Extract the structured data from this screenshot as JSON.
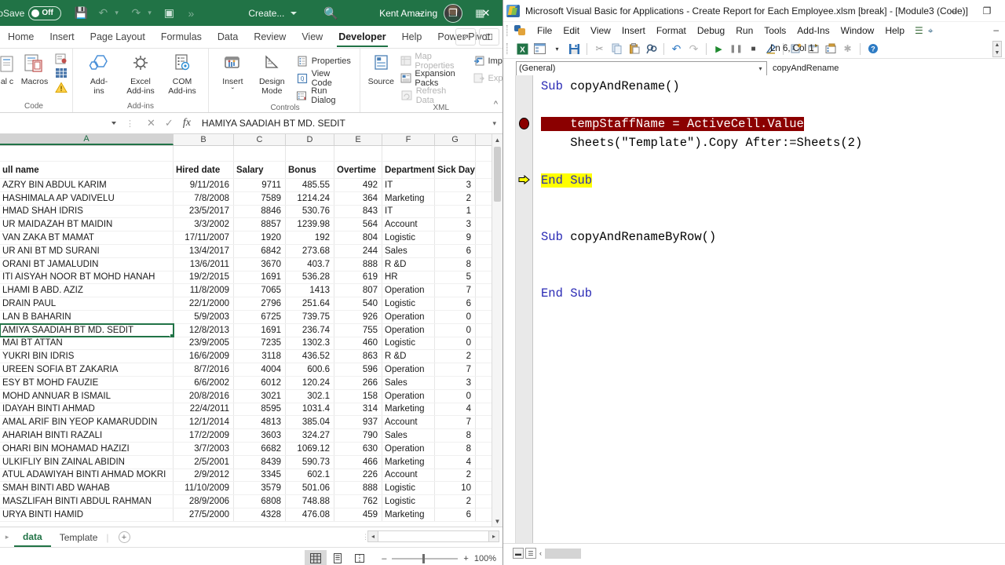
{
  "excel": {
    "titlebar": {
      "autosave_label": "toSave",
      "autosave_state": "Off",
      "qat": [
        "save-icon",
        "undo-icon",
        "redo-icon",
        "touch-mode-icon",
        "more-icon"
      ],
      "create_label": "Create...",
      "search_icon": "search-icon",
      "user_name": "Kent Amazing",
      "ribbon_display_icon": "ribbon-display-options-icon",
      "window_minimize": "–",
      "window_restore": "❐",
      "window_close": "✕"
    },
    "tabs": [
      {
        "label": "Home",
        "active": false
      },
      {
        "label": "Insert",
        "active": false
      },
      {
        "label": "Page Layout",
        "active": false
      },
      {
        "label": "Formulas",
        "active": false
      },
      {
        "label": "Data",
        "active": false
      },
      {
        "label": "Review",
        "active": false
      },
      {
        "label": "View",
        "active": false
      },
      {
        "label": "Developer",
        "active": true
      },
      {
        "label": "Help",
        "active": false
      },
      {
        "label": "Power Pivot",
        "active": false
      }
    ],
    "tab_right": [
      "share-icon",
      "comments-icon"
    ],
    "ribbon": {
      "groups": [
        {
          "title": "Code",
          "big": [
            {
              "label": "al\nc",
              "icon": "visual-basic-icon"
            },
            {
              "label": "Macros",
              "icon": "macros-icon"
            }
          ],
          "icons": [
            "record-macro-icon",
            "use-relative-references-icon",
            "macro-security-icon"
          ]
        },
        {
          "title": "Add-ins",
          "big": [
            {
              "label": "Add-\nins",
              "icon": "addins-icon"
            },
            {
              "label": "Excel\nAdd-ins",
              "icon": "excel-addins-icon"
            },
            {
              "label": "COM\nAdd-ins",
              "icon": "com-addins-icon"
            }
          ],
          "icons": []
        },
        {
          "title": "Controls",
          "big": [
            {
              "label": "Insert\nˇ",
              "icon": "insert-control-icon"
            },
            {
              "label": "Design\nMode",
              "icon": "design-mode-icon"
            }
          ],
          "small": [
            {
              "label": "Properties",
              "icon": "properties-icon",
              "disabled": false
            },
            {
              "label": "View Code",
              "icon": "view-code-icon",
              "disabled": false
            },
            {
              "label": "Run Dialog",
              "icon": "run-dialog-icon",
              "disabled": false
            }
          ]
        },
        {
          "title": "XML",
          "big": [
            {
              "label": "Source",
              "icon": "xml-source-icon"
            }
          ],
          "small": [
            {
              "label": "Map Properties",
              "icon": "map-properties-icon",
              "disabled": true
            },
            {
              "label": "Expansion Packs",
              "icon": "expansion-packs-icon",
              "disabled": false
            },
            {
              "label": "Refresh Data",
              "icon": "refresh-data-icon",
              "disabled": true
            }
          ],
          "small2": [
            {
              "label": "Import",
              "icon": "import-icon",
              "disabled": false
            },
            {
              "label": "Export",
              "icon": "export-icon",
              "disabled": true
            }
          ]
        }
      ],
      "collapse_icon": "collapse-ribbon-icon"
    },
    "formula_bar": {
      "name_box_value": "",
      "cancel_icon": "cancel-icon",
      "enter_icon": "enter-icon",
      "fx_icon": "insert-function-icon",
      "formula_value": "HAMIYA SAADIAH BT MD. SEDIT",
      "expand_icon": "expand-formula-bar-icon"
    },
    "grid": {
      "column_headers": [
        "A",
        "B",
        "C",
        "D",
        "E",
        "F",
        "G"
      ],
      "selected_column": "A",
      "selected_cell_text": "HAMIYA SAADIAH BT MD. SEDIT",
      "header_row": [
        "ull name",
        "Hired date",
        "Salary",
        "Bonus",
        "Overtime",
        "Department",
        "Sick Day"
      ],
      "rows": [
        [
          "AZRY BIN ABDUL KARIM",
          "9/11/2016",
          "9711",
          "485.55",
          "492",
          "IT",
          "3"
        ],
        [
          "HASHIMALA AP VADIVELU",
          "7/8/2008",
          "7589",
          "1214.24",
          "364",
          "Marketing",
          "2"
        ],
        [
          "HMAD SHAH IDRIS",
          "23/5/2017",
          "8846",
          "530.76",
          "843",
          "IT",
          "1"
        ],
        [
          "UR MAIDAZAH BT MAIDIN",
          "3/3/2002",
          "8857",
          "1239.98",
          "564",
          "Account",
          "3"
        ],
        [
          "VAN ZAKA BT MAMAT",
          "17/11/2007",
          "1920",
          "192",
          "804",
          "Logistic",
          "9"
        ],
        [
          "UR ANI BT MD SURANI",
          "13/4/2017",
          "6842",
          "273.68",
          "244",
          "Sales",
          "6"
        ],
        [
          "ORANI BT JAMALUDIN",
          "13/6/2011",
          "3670",
          "403.7",
          "888",
          "R &D",
          "8"
        ],
        [
          "ITI AISYAH NOOR BT MOHD HANAH",
          "19/2/2015",
          "1691",
          "536.28",
          "619",
          "HR",
          "5"
        ],
        [
          "LHAMI B ABD. AZIZ",
          "11/8/2009",
          "7065",
          "1413",
          "807",
          "Operation",
          "7"
        ],
        [
          "DRAIN PAUL",
          "22/1/2000",
          "2796",
          "251.64",
          "540",
          "Logistic",
          "6"
        ],
        [
          "LAN B BAHARIN",
          "5/9/2003",
          "6725",
          "739.75",
          "926",
          "Operation",
          "0"
        ],
        [
          "AMIYA SAADIAH BT MD. SEDIT",
          "12/8/2013",
          "1691",
          "236.74",
          "755",
          "Operation",
          "0"
        ],
        [
          "MAI BT ATTAN",
          "23/9/2005",
          "7235",
          "1302.3",
          "460",
          "Logistic",
          "0"
        ],
        [
          "YUKRI BIN IDRIS",
          "16/6/2009",
          "3118",
          "436.52",
          "863",
          "R &D",
          "2"
        ],
        [
          "UREEN SOFIA BT ZAKARIA",
          "8/7/2016",
          "4004",
          "600.6",
          "596",
          "Operation",
          "7"
        ],
        [
          "ESY BT MOHD FAUZIE",
          "6/6/2002",
          "6012",
          "120.24",
          "266",
          "Sales",
          "3"
        ],
        [
          "MOHD ANNUAR B ISMAIL",
          "20/8/2016",
          "3021",
          "302.1",
          "158",
          "Operation",
          "0"
        ],
        [
          "IDAYAH BINTI AHMAD",
          "22/4/2011",
          "8595",
          "1031.4",
          "314",
          "Marketing",
          "4"
        ],
        [
          "AMAL ARIF BIN YEOP KAMARUDDIN",
          "12/1/2014",
          "4813",
          "385.04",
          "937",
          "Account",
          "7"
        ],
        [
          "AHARIAH BINTI RAZALI",
          "17/2/2009",
          "3603",
          "324.27",
          "790",
          "Sales",
          "8"
        ],
        [
          "OHARI BIN MOHAMAD HAZIZI",
          "3/7/2003",
          "6682",
          "1069.12",
          "630",
          "Operation",
          "8"
        ],
        [
          "ULKIFLIY BIN ZAINAL ABIDIN",
          "2/5/2001",
          "8439",
          "590.73",
          "466",
          "Marketing",
          "4"
        ],
        [
          "ATUL ADAWIYAH BINTI AHMAD MOKRI",
          "2/9/2012",
          "3345",
          "602.1",
          "226",
          "Account",
          "2"
        ],
        [
          "SMAH BINTI ABD WAHAB",
          "11/10/2009",
          "3579",
          "501.06",
          "888",
          "Logistic",
          "10"
        ],
        [
          "MASZLIFAH BINTI ABDUL RAHMAN",
          "28/9/2006",
          "6808",
          "748.88",
          "762",
          "Logistic",
          "2"
        ],
        [
          "URYA BINTI HAMID",
          "27/5/2000",
          "4328",
          "476.08",
          "459",
          "Marketing",
          "6"
        ]
      ],
      "selected_row_index": 11
    },
    "sheet_tabs": [
      {
        "label": "data",
        "active": true
      },
      {
        "label": "Template",
        "active": false
      }
    ],
    "add_sheet_icon": "add-sheet-icon",
    "status": {
      "view_buttons": [
        "normal-view-icon",
        "page-layout-view-icon",
        "page-break-view-icon"
      ],
      "zoom_out_label": "–",
      "zoom_in_label": "+",
      "zoom_level": "100%"
    }
  },
  "vba": {
    "title": "Microsoft Visual Basic for Applications - Create Report for Each Employee.xlsm [break] - [Module3 (Code)]",
    "app_icon": "vba-app-icon",
    "window_minimize": "–",
    "window_restore": "❐",
    "inner_minimize": "–",
    "menus": [
      "File",
      "Edit",
      "View",
      "Insert",
      "Format",
      "Debug",
      "Run",
      "Tools",
      "Add-Ins",
      "Window",
      "Help"
    ],
    "menu_right_icons": [
      "project-explorer-icon",
      "object-browser-icon"
    ],
    "toolbar": {
      "icons": [
        "view-excel-icon",
        "insert-userform-icon",
        "insert-dropdown-icon",
        "save-icon",
        "cut-icon",
        "copy-icon",
        "paste-icon",
        "find-icon",
        "undo-icon",
        "redo-icon",
        "run-icon",
        "break-icon",
        "reset-icon",
        "design-mode-icon",
        "project-explorer-icon",
        "properties-window-icon",
        "object-browser-icon",
        "toolbox-icon",
        "help-icon"
      ],
      "position_label": "Ln 6, Col 1"
    },
    "dropdowns": {
      "object": "(General)",
      "procedure": "copyAndRename"
    },
    "code_lines": [
      {
        "text": "Sub copyAndRename()",
        "style": "keyword-lead",
        "marker": "none"
      },
      {
        "text": "",
        "style": "plain",
        "marker": "none"
      },
      {
        "text": "    tempStaffName = ActiveCell.Value",
        "style": "breakpoint",
        "marker": "breakpoint"
      },
      {
        "text": "    Sheets(\"Template\").Copy After:=Sheets(2)",
        "style": "plain",
        "marker": "none"
      },
      {
        "text": "",
        "style": "plain",
        "marker": "none"
      },
      {
        "text": "End Sub",
        "style": "highlight",
        "marker": "current-line-arrow"
      },
      {
        "text": "",
        "style": "plain",
        "marker": "none"
      },
      {
        "text": "",
        "style": "plain",
        "marker": "none"
      },
      {
        "text": "Sub copyAndRenameByRow()",
        "style": "keyword-lead",
        "marker": "none"
      },
      {
        "text": "",
        "style": "plain",
        "marker": "none"
      },
      {
        "text": "",
        "style": "plain",
        "marker": "none"
      },
      {
        "text": "End Sub",
        "style": "keyword-lead",
        "marker": "none"
      }
    ],
    "bottom_bar": {
      "procedure_view_icon": "procedure-view-icon",
      "full_module_view_icon": "full-module-view-icon",
      "scroll_left_icon": "‹"
    }
  },
  "colors": {
    "excel_green": "#217346",
    "breakpoint_red": "#8b0000",
    "current_line_yellow": "#ffff00",
    "vba_keyword_blue": "#2a2ab5"
  }
}
